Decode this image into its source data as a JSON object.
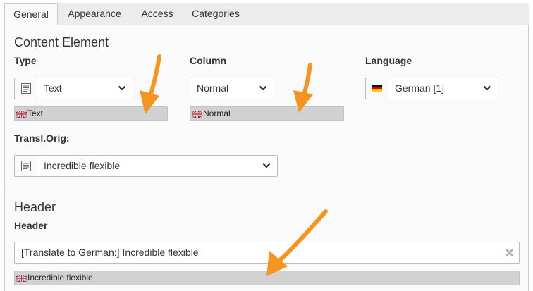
{
  "tabs": [
    {
      "label": "General",
      "active": true
    },
    {
      "label": "Appearance",
      "active": false
    },
    {
      "label": "Access",
      "active": false
    },
    {
      "label": "Categories",
      "active": false
    }
  ],
  "content_element": {
    "title": "Content Element",
    "type": {
      "label": "Type",
      "value": "Text",
      "original": "Text",
      "icon": "text-content-icon"
    },
    "column": {
      "label": "Column",
      "value": "Normal",
      "original": "Normal"
    },
    "language": {
      "label": "Language",
      "value": "German [1]",
      "icon": "flag-de-icon"
    },
    "transl_orig": {
      "label": "Transl.Orig:",
      "value": "Incredible flexible",
      "icon": "text-content-icon"
    }
  },
  "header": {
    "title": "Header",
    "field": {
      "label": "Header",
      "value": "[Translate to German:] Incredible flexible",
      "original": "Incredible flexible"
    }
  },
  "colors": {
    "annotation_arrow": "#f7941d",
    "original_bar": "#d1d1d1",
    "panel_bg": "#fafafa"
  }
}
